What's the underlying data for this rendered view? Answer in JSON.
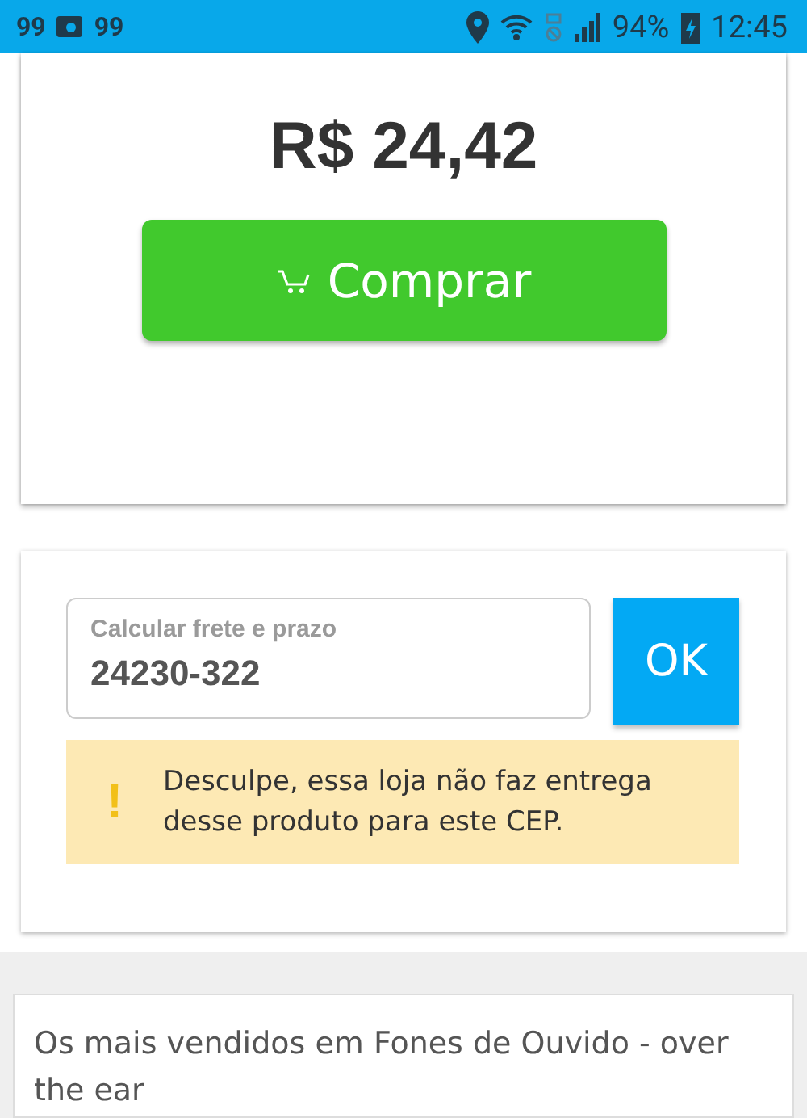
{
  "status_bar": {
    "notifications": [
      "99",
      "99"
    ],
    "battery": "94%",
    "time": "12:45"
  },
  "product": {
    "price": "R$ 24,42",
    "buy_button": "Comprar"
  },
  "freight": {
    "label": "Calcular frete e prazo",
    "value": "24230-322",
    "button": "OK",
    "alert": {
      "icon": "!",
      "message": "Desculpe, essa loja não faz entrega desse produto para este CEP."
    }
  },
  "bestsellers": {
    "title": "Os mais vendidos em Fones de Ouvido - over the ear"
  }
}
